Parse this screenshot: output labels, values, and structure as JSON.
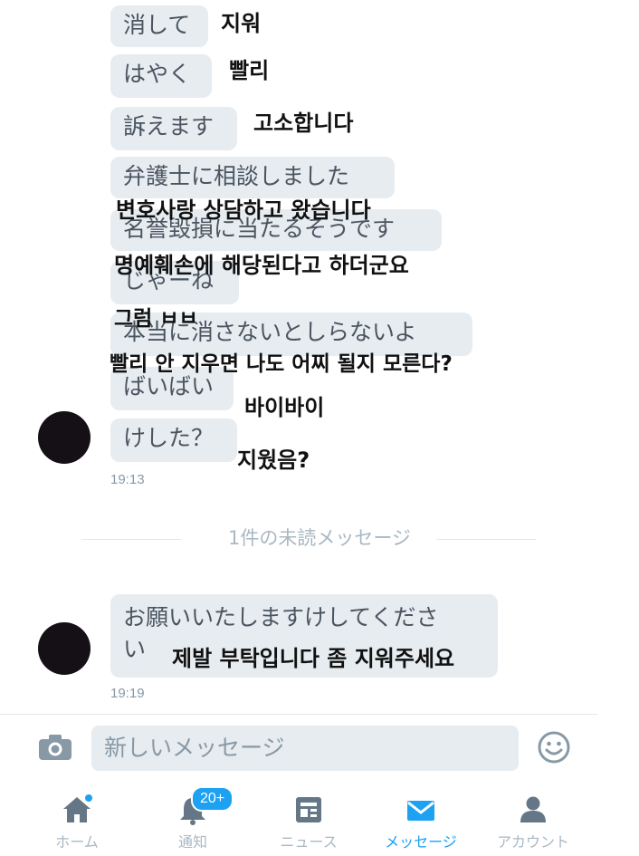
{
  "messages": [
    {
      "jp": "消して",
      "ko": "지워"
    },
    {
      "jp": "はやく",
      "ko": "빨리"
    },
    {
      "jp": "訴えます",
      "ko": "고소합니다"
    },
    {
      "jp": "弁護士に相談しました",
      "ko": "변호사랑 상담하고 왔습니다"
    },
    {
      "jp": "名誉毀損に当たるそうです",
      "ko": "명예훼손에 해당된다고 하더군요"
    },
    {
      "jp": "じゃーね",
      "ko": "그럼 ㅂㅂ"
    },
    {
      "jp": "本当に消さないとしらないよ",
      "ko": "빨리 안 지우면 나도 어찌 될지 모른다?"
    },
    {
      "jp": "ばいばい",
      "ko": "바이바이"
    },
    {
      "jp": "けした？",
      "ko": "지웠음?"
    }
  ],
  "time_1": "19:13",
  "unread_divider": "1件の未読メッセージ",
  "last_message": {
    "jp_line1": "お願いいたしますけしてくださ",
    "jp_line2": "い",
    "ko": "제발 부탁입니다 좀 지워주세요"
  },
  "time_2": "19:19",
  "compose": {
    "placeholder": "新しいメッセージ",
    "camera_icon": "camera-icon",
    "emoji_icon": "smiley-icon"
  },
  "tabs": [
    {
      "label": "ホーム",
      "icon": "home-icon"
    },
    {
      "label": "通知",
      "icon": "bell-icon"
    },
    {
      "label": "ニュース",
      "icon": "news-icon"
    },
    {
      "label": "メッセージ",
      "icon": "envelope-icon"
    },
    {
      "label": "アカウント",
      "icon": "person-icon"
    }
  ],
  "notification_badge": "20+",
  "colors": {
    "accent": "#1da1f2",
    "bubble": "#e6ecf0",
    "muted": "#aab8c2"
  }
}
